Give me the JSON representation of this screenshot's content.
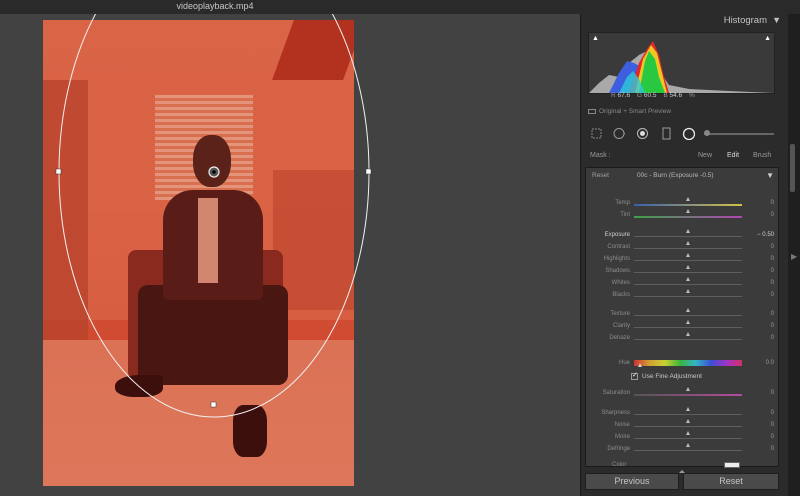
{
  "window": {
    "title": "videoplayback.mp4"
  },
  "histogram": {
    "title": "Histogram",
    "readout": {
      "r_label": "R",
      "r_value": "67.6",
      "g_label": "G",
      "g_value": "60.5",
      "b_label": "B",
      "b_value": "54.6",
      "unit": "%"
    },
    "preview_status": "Original + Smart Preview"
  },
  "mask": {
    "label": "Mask :",
    "new": "New",
    "edit": "Edit",
    "brush": "Brush"
  },
  "adjustments": {
    "reset": "Reset",
    "preset": "00c - Burn (Exposure -0.5)",
    "rows_a": [
      {
        "name": "Temp",
        "value": "0",
        "track": "temp"
      },
      {
        "name": "Tint",
        "value": "0",
        "track": "tint"
      }
    ],
    "rows_b": [
      {
        "name": "Exposure",
        "value": "− 0.50",
        "active": true
      },
      {
        "name": "Contrast",
        "value": "0"
      },
      {
        "name": "Highlights",
        "value": "0"
      },
      {
        "name": "Shadows",
        "value": "0"
      },
      {
        "name": "Whites",
        "value": "0"
      },
      {
        "name": "Blacks",
        "value": "0"
      }
    ],
    "rows_c": [
      {
        "name": "Texture",
        "value": "0"
      },
      {
        "name": "Clarity",
        "value": "0"
      },
      {
        "name": "Dehaze",
        "value": "0"
      }
    ],
    "hue": {
      "name": "Hue",
      "value": "0.0"
    },
    "fine_adjustment": "Use Fine Adjustment",
    "rows_d": [
      {
        "name": "Saturation",
        "value": "0",
        "track": "sat"
      }
    ],
    "rows_e": [
      {
        "name": "Sharpness",
        "value": "0"
      },
      {
        "name": "Noise",
        "value": "0"
      },
      {
        "name": "Moire",
        "value": "0"
      },
      {
        "name": "Defringe",
        "value": "0"
      }
    ],
    "color_label": "Color"
  },
  "buttons": {
    "previous": "Previous",
    "reset": "Reset"
  },
  "colors": {
    "mask_overlay": "#d9573a",
    "panel_bg": "#3b3b3b",
    "canvas_bg": "#424242"
  }
}
